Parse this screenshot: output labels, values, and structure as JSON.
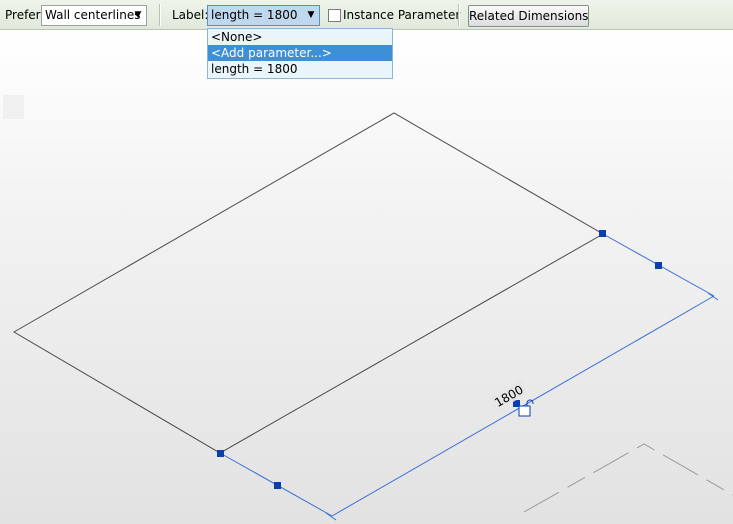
{
  "options_bar": {
    "prefer_label": "Prefer:",
    "prefer_value": "Wall centerlines",
    "label_label": "Label:",
    "label_value": "length = 1800",
    "instance_parameter_label": "Instance Parameter",
    "instance_parameter_checked": false,
    "related_dimensions_label": "Related Dimensions"
  },
  "label_dropdown": {
    "options": [
      "<None>",
      "<Add parameter...>",
      "length = 1800"
    ],
    "highlighted": "<Add parameter...>"
  },
  "canvas": {
    "dimension_text": "1800"
  },
  "colors": {
    "options_bar_bg": "#e5eee1",
    "selection_blue": "#3d8fd6",
    "dimension_line": "#3a6fd8",
    "grip": "#0a3fb0",
    "geometry_line": "#4a4a4a"
  }
}
